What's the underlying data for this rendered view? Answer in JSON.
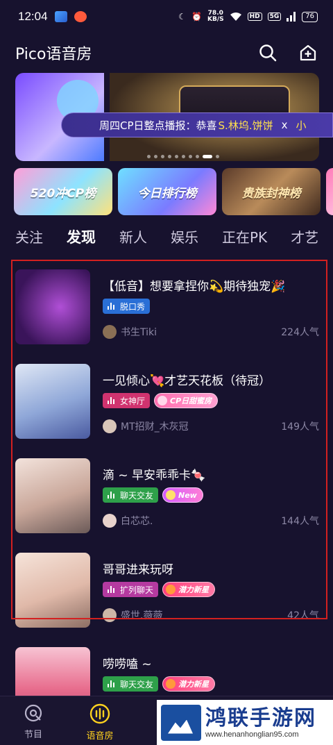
{
  "status_bar": {
    "time": "12:04",
    "net_speed_value": "78.0",
    "net_speed_unit": "KB/S",
    "hd": "HD",
    "signal": "5G",
    "battery": "76"
  },
  "header": {
    "title": "Pico语音房"
  },
  "banner": {
    "broadcast_prefix": "周四CP日整点播报：恭喜",
    "broadcast_name": "S.林坞.饼饼",
    "broadcast_x": "x",
    "broadcast_tail": "小"
  },
  "rank_cards": [
    {
      "label": "520冲CP榜"
    },
    {
      "label": "今日排行榜"
    },
    {
      "label": "贵族封神榜"
    }
  ],
  "tabs": [
    {
      "label": "关注",
      "active": false
    },
    {
      "label": "发现",
      "active": true
    },
    {
      "label": "新人",
      "active": false
    },
    {
      "label": "娱乐",
      "active": false
    },
    {
      "label": "正在PK",
      "active": false
    },
    {
      "label": "才艺",
      "active": false
    }
  ],
  "rooms": [
    {
      "title": "【低音】想要拿捏你💫期待独宠🎉",
      "tag": "脱口秀",
      "badge": "",
      "owner": "书生Tiki",
      "popularity": "224人气"
    },
    {
      "title": "一见倾心💘才艺天花板（待冠）",
      "tag": "女神厅",
      "badge": "CP日甜蜜房",
      "owner": "MT招财_木灰冠",
      "popularity": "149人气"
    },
    {
      "title": "滴 ~ 早安乖乖卡🍬",
      "tag": "聊天交友",
      "badge": "New",
      "owner": "白芯芯.",
      "popularity": "144人气"
    },
    {
      "title": "哥哥进来玩呀",
      "tag": "扩列聊天",
      "badge": "潜力新星",
      "owner": "盛世.薇薇",
      "popularity": "42人气"
    },
    {
      "title": "唠唠嗑 ~",
      "tag": "聊天交友",
      "badge": "潜力新星",
      "owner": "",
      "popularity": ""
    }
  ],
  "bottom_nav": [
    {
      "label": "节目"
    },
    {
      "label": "语音房"
    }
  ],
  "watermark": {
    "name": "鸿联手游网",
    "url": "www.henanhonglian95.com"
  },
  "colors": {
    "background": "#17122e",
    "accent_pink": "#ff5fa8",
    "accent_yellow": "#ffd21f",
    "highlight_red": "#d32020"
  }
}
